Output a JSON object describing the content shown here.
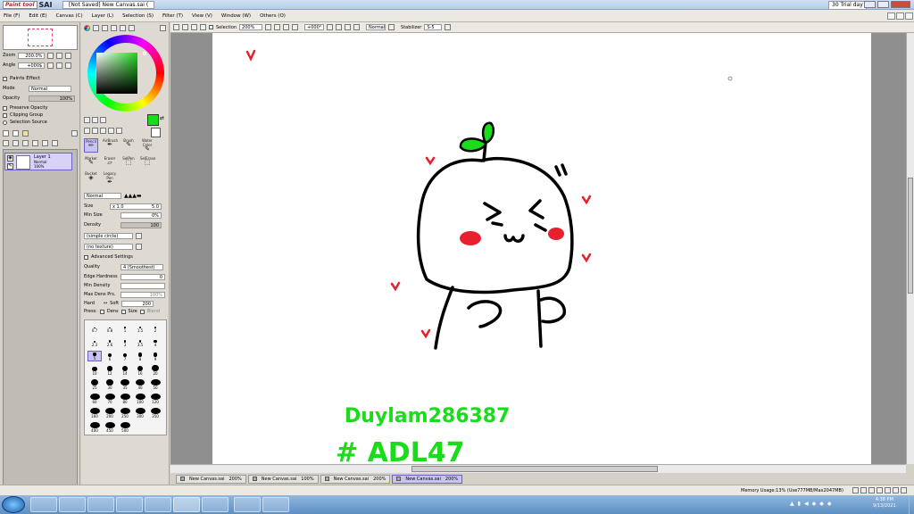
{
  "window": {
    "app_logo_text": "Paint tool",
    "app_name": "SAI",
    "doc_title": "[Not Saved] New Canvas.sai (",
    "trial": "30 Trial day"
  },
  "menu": [
    "File (F)",
    "Edit (E)",
    "Canvas (C)",
    "Layer (L)",
    "Selection (S)",
    "Filter (T)",
    "View (V)",
    "Window (W)",
    "Others (O)"
  ],
  "navigator": {
    "zoom_label": "Zoom",
    "zoom_value": "200.0%",
    "angle_label": "Angle",
    "angle_value": "+000$"
  },
  "layer_props": {
    "section": "Paints Effect",
    "mode_label": "Mode",
    "mode_value": "Normal",
    "opacity_label": "Opacity",
    "opacity_value": "100%",
    "options": [
      "Preserve Opacity",
      "Clipping Group",
      "Selection Source"
    ]
  },
  "layers": [
    {
      "name": "Layer 1",
      "mode": "Normal",
      "opacity": "100%"
    }
  ],
  "colors": {
    "current": "#1bdc1b",
    "accent": "#6a60c8",
    "drawing_red": "#e81f2e"
  },
  "tools": [
    {
      "label": "Pencil",
      "selected": true
    },
    {
      "label": "AirBrush"
    },
    {
      "label": "Brush"
    },
    {
      "label": "Water Color"
    },
    {
      "label": "Marker"
    },
    {
      "label": "Eraser"
    },
    {
      "label": "SelPen"
    },
    {
      "label": "SelErase"
    },
    {
      "label": "Bucket"
    },
    {
      "label": "Legacy Pen"
    }
  ],
  "brush": {
    "blend": "Normal",
    "size_label": "Size",
    "size_mult": "x 1.0",
    "size_value": "5.0",
    "min_size_label": "Min Size",
    "min_size_value": "0%",
    "density_label": "Density",
    "density_value": "100",
    "shape": "(simple circle)",
    "texture": "(no texture)",
    "adv_label": "Advanced Settings",
    "quality_label": "Quality",
    "quality_value": "4 (Smoothest)",
    "edge_label": "Edge Hardness",
    "edge_value": "0",
    "min_density_label": "Min Density",
    "max_press_label": "Max Dens Prs.",
    "max_press_value": "100%",
    "hard_label": "Hard",
    "soft_label": "Soft",
    "hard_value": "200",
    "press_label": "Press:",
    "dens": "Dens",
    "size": "Size",
    "blend2": "Blend"
  },
  "brush_sizes": [
    "0.7",
    "0.8",
    "1",
    "1.5",
    "2",
    "2.3",
    "2.6",
    "3",
    "3.5",
    "4",
    "5",
    "6",
    "7",
    "8",
    "9",
    "10",
    "12",
    "14",
    "16",
    "20",
    "25",
    "30",
    "35",
    "40",
    "50",
    "60",
    "70",
    "80",
    "100",
    "120",
    "160",
    "200",
    "250",
    "300",
    "350",
    "400",
    "450",
    "500"
  ],
  "canvas_toolbar": {
    "selection": "Selection",
    "zoom": "200%",
    "angle": "+000°",
    "mode": "Normal",
    "stabilizer_label": "Stabilizer",
    "stabilizer_value": "S-5"
  },
  "canvas_text": {
    "line1": "Duylam286387",
    "line2": "# ADL47"
  },
  "tabs": [
    {
      "name": "New Canvas.sai",
      "zoom": "200%"
    },
    {
      "name": "New Canvas.sai",
      "zoom": "100%"
    },
    {
      "name": "New Canvas.sai",
      "zoom": "200%"
    },
    {
      "name": "New Canvas.sai",
      "zoom": "200%",
      "active": true
    }
  ],
  "status": {
    "memory": "Memory Usage:13% (Use777MB/Max2047MB)"
  },
  "taskbar": {
    "time": "4:38 PM",
    "date": "9/13/2021"
  }
}
